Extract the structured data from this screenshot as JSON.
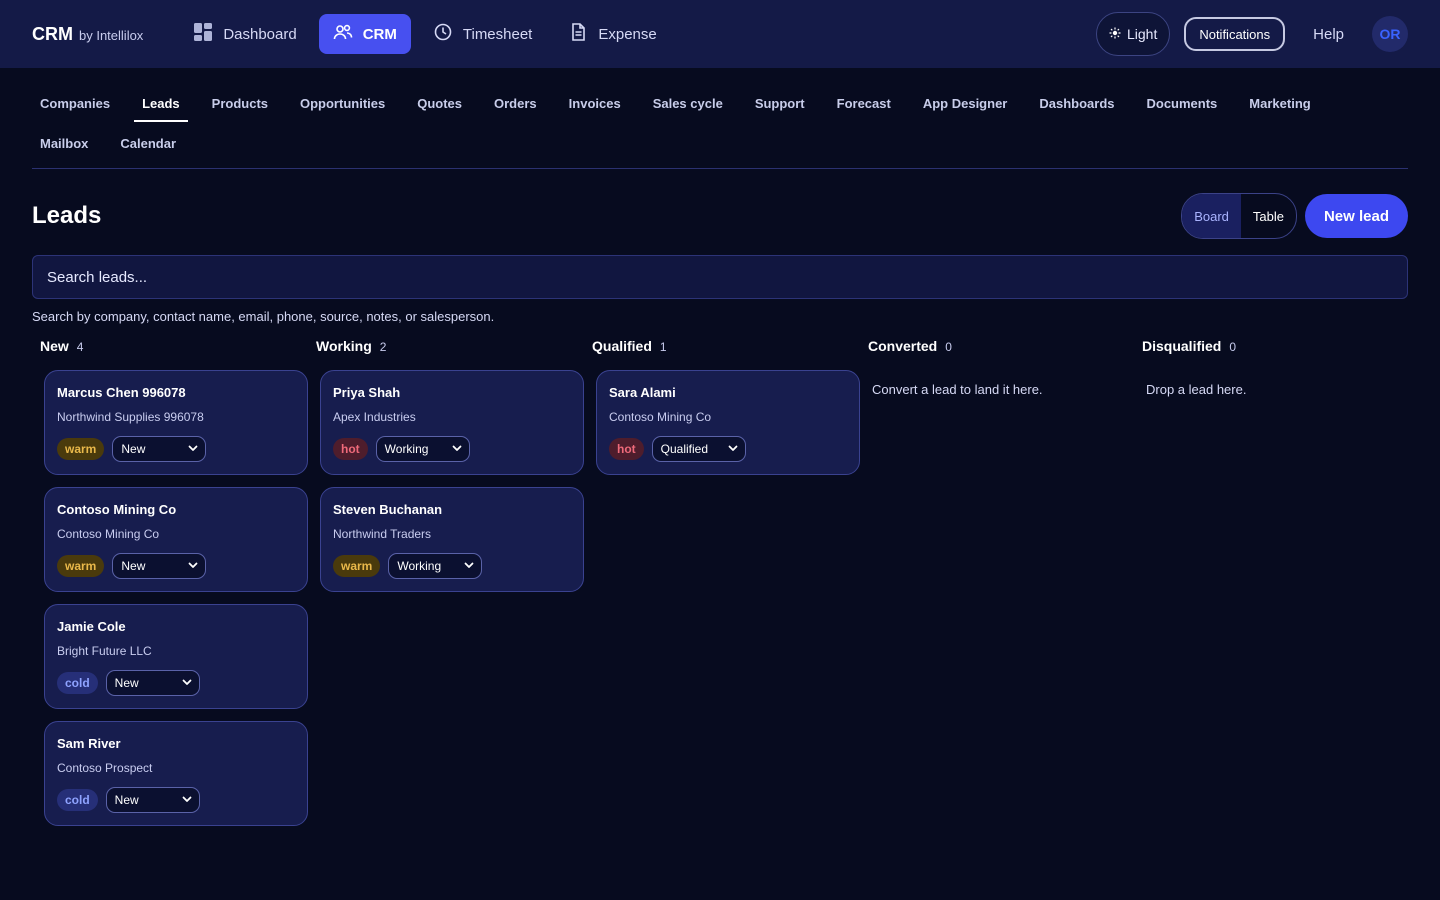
{
  "brand": {
    "name": "CRM",
    "by": "by Intellilox"
  },
  "topnav": [
    {
      "label": "Dashboard",
      "icon": "dashboard-icon",
      "active": false
    },
    {
      "label": "CRM",
      "icon": "people-icon",
      "active": true
    },
    {
      "label": "Timesheet",
      "icon": "clock-icon",
      "active": false
    },
    {
      "label": "Expense",
      "icon": "document-icon",
      "active": false
    }
  ],
  "topright": {
    "light_label": "Light",
    "notifications_label": "Notifications",
    "help_label": "Help",
    "avatar_initials": "OR"
  },
  "subnav": {
    "items": [
      "Companies",
      "Leads",
      "Products",
      "Opportunities",
      "Quotes",
      "Orders",
      "Invoices",
      "Sales cycle",
      "Support",
      "Forecast",
      "App Designer",
      "Dashboards",
      "Documents",
      "Marketing",
      "Mailbox",
      "Calendar"
    ],
    "active": "Leads"
  },
  "page": {
    "title": "Leads",
    "board_label": "Board",
    "table_label": "Table",
    "new_lead_label": "New lead"
  },
  "search": {
    "placeholder": "Search leads...",
    "hint": "Search by company, contact name, email, phone, source, notes, or salesperson."
  },
  "columns": [
    {
      "title": "New",
      "count": "4",
      "empty_text": "",
      "cards": [
        {
          "name": "Marcus Chen 996078",
          "company": "Northwind Supplies 996078",
          "temp": "warm",
          "status": "New"
        },
        {
          "name": "Contoso Mining Co",
          "company": "Contoso Mining Co",
          "temp": "warm",
          "status": "New"
        },
        {
          "name": "Jamie Cole",
          "company": "Bright Future LLC",
          "temp": "cold",
          "status": "New"
        },
        {
          "name": "Sam River",
          "company": "Contoso Prospect",
          "temp": "cold",
          "status": "New"
        }
      ]
    },
    {
      "title": "Working",
      "count": "2",
      "empty_text": "",
      "cards": [
        {
          "name": "Priya Shah",
          "company": "Apex Industries",
          "temp": "hot",
          "status": "Working"
        },
        {
          "name": "Steven Buchanan",
          "company": "Northwind Traders",
          "temp": "warm",
          "status": "Working"
        }
      ]
    },
    {
      "title": "Qualified",
      "count": "1",
      "empty_text": "",
      "cards": [
        {
          "name": "Sara Alami",
          "company": "Contoso Mining Co",
          "temp": "hot",
          "status": "Qualified"
        }
      ]
    },
    {
      "title": "Converted",
      "count": "0",
      "empty_text": "Convert a lead to land it here.",
      "cards": []
    },
    {
      "title": "Disqualified",
      "count": "0",
      "empty_text": "Drop a lead here.",
      "cards": []
    }
  ],
  "colors": {
    "accent": "#3d48f0",
    "topbar": "#141a47",
    "background": "#070b1f",
    "warm": "#e9b84a",
    "hot": "#ef6a7a",
    "cold": "#8fa3ff"
  }
}
